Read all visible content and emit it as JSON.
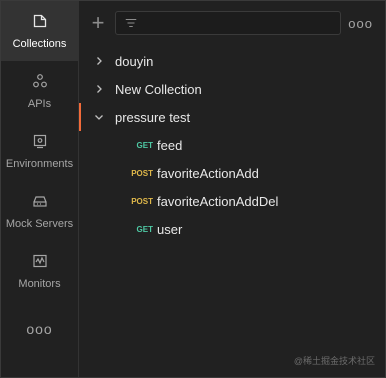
{
  "sidebar": {
    "items": [
      {
        "label": "Collections",
        "icon": "collections-icon",
        "active": true
      },
      {
        "label": "APIs",
        "icon": "apis-icon",
        "active": false
      },
      {
        "label": "Environments",
        "icon": "environments-icon",
        "active": false
      },
      {
        "label": "Mock Servers",
        "icon": "mock-servers-icon",
        "active": false
      },
      {
        "label": "Monitors",
        "icon": "monitors-icon",
        "active": false
      }
    ],
    "more_label": "ooo"
  },
  "toolbar": {
    "add_label": "+",
    "filter_placeholder": "",
    "more_label": "ooo"
  },
  "collections": [
    {
      "name": "douyin",
      "expanded": false
    },
    {
      "name": "New Collection",
      "expanded": false
    },
    {
      "name": "pressure test",
      "expanded": true,
      "requests": [
        {
          "method": "GET",
          "name": "feed"
        },
        {
          "method": "POST",
          "name": "favoriteActionAdd"
        },
        {
          "method": "POST",
          "name": "favoriteActionAddDel"
        },
        {
          "method": "GET",
          "name": "user"
        }
      ]
    }
  ],
  "colors": {
    "accent": "#f26b3a",
    "get": "#4ec9a4",
    "post": "#e0b84a"
  },
  "watermark": "@稀土掘金技术社区"
}
